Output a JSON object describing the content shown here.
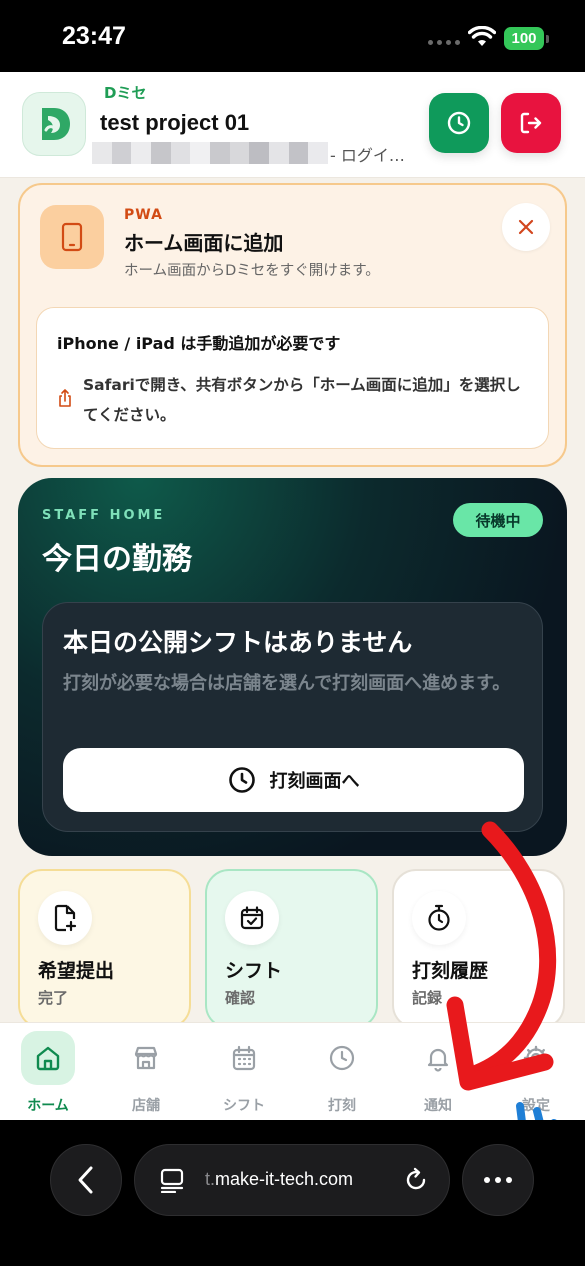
{
  "status_bar": {
    "time": "23:47",
    "battery": "100"
  },
  "header": {
    "brand": "Dミセ",
    "project": "test project 01",
    "user_suffix": "- ログイ…",
    "clock_icon": "clock-icon",
    "logout_icon": "logout-icon",
    "accent_green": "#0f9a5b",
    "accent_red": "#e8133f"
  },
  "pwa": {
    "tag": "PWA",
    "title": "ホーム画面に追加",
    "subtitle": "ホーム画面からDミセをすぐ開けます。",
    "inner_title": "iPhone / iPad は手動追加が必要です",
    "instruction": "Safariで開き、共有ボタンから「ホーム画面に追加」を選択してください。"
  },
  "staff": {
    "tag": "STAFF HOME",
    "title": "今日の勤務",
    "status": "待機中",
    "shift_title": "本日の公開シフトはありません",
    "shift_desc": "打刻が必要な場合は店舗を選んで打刻画面へ進めます。",
    "punch_button": "打刻画面へ"
  },
  "tiles": [
    {
      "title": "希望提出",
      "sub": "完了",
      "icon": "document-plus-icon"
    },
    {
      "title": "シフト",
      "sub": "確認",
      "icon": "calendar-check-icon"
    },
    {
      "title": "打刻履歴",
      "sub": "記録",
      "icon": "stopwatch-icon"
    }
  ],
  "nav": [
    {
      "label": "ホーム",
      "icon": "home-icon",
      "active": true
    },
    {
      "label": "店舗",
      "icon": "store-icon"
    },
    {
      "label": "シフト",
      "icon": "calendar-icon"
    },
    {
      "label": "打刻",
      "icon": "clock-icon"
    },
    {
      "label": "通知",
      "icon": "bell-icon"
    },
    {
      "label": "設定",
      "icon": "gear-icon"
    }
  ],
  "browser": {
    "url_prefix": "t.",
    "url": "make-it-tech.com"
  }
}
